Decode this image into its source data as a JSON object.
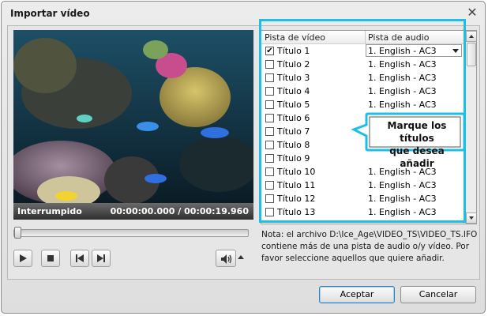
{
  "window": {
    "title": "Importar vídeo",
    "close_glyph": "✕"
  },
  "player": {
    "status": "Interrumpido",
    "time": "00:00:00.000 / 00:00:19.960",
    "progress": 0
  },
  "list": {
    "columns": [
      "Pista de vídeo",
      "Pista de audio"
    ],
    "rows": [
      {
        "title": "Título 1",
        "audio": "1. English - AC3",
        "checked": true
      },
      {
        "title": "Título 2",
        "audio": "1. English - AC3",
        "checked": false
      },
      {
        "title": "Título 3",
        "audio": "1. English - AC3",
        "checked": false
      },
      {
        "title": "Título 4",
        "audio": "1. English - AC3",
        "checked": false
      },
      {
        "title": "Título 5",
        "audio": "1. English - AC3",
        "checked": false
      },
      {
        "title": "Título 6",
        "audio": "",
        "checked": false
      },
      {
        "title": "Título 7",
        "audio": "",
        "checked": false
      },
      {
        "title": "Título 8",
        "audio": "",
        "checked": false
      },
      {
        "title": "Título 9",
        "audio": "",
        "checked": false
      },
      {
        "title": "Título 10",
        "audio": "1. English - AC3",
        "checked": false
      },
      {
        "title": "Título 11",
        "audio": "1. English - AC3",
        "checked": false
      },
      {
        "title": "Título 12",
        "audio": "1. English - AC3",
        "checked": false
      },
      {
        "title": "Título 13",
        "audio": "1. English - AC3",
        "checked": false
      }
    ]
  },
  "callout": {
    "line1": "Marque los títulos",
    "line2": "que desea añadir"
  },
  "note": "Nota: el archivo  D:\\Ice_Age\\VIDEO_TS\\VIDEO_TS.IFO contiene más de una pista de audio o/y vídeo. Por favor seleccione aquellos que quiere añadir.",
  "buttons": {
    "ok": "Aceptar",
    "cancel": "Cancelar"
  },
  "icons": {
    "play": "play-icon",
    "stop": "stop-icon",
    "prev": "previous-icon",
    "next": "next-icon",
    "volume": "volume-icon",
    "dropdown": "chevron-down-icon"
  },
  "colors": {
    "highlight": "#1ebfe6",
    "callout_border": "#1ebfe6"
  }
}
